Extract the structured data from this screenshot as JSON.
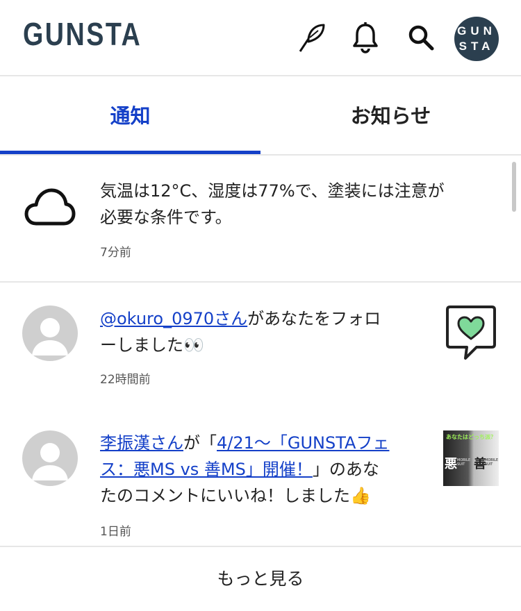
{
  "header": {
    "logo": "GUNSTA",
    "avatar_line1": "GUN",
    "avatar_line2": "STA"
  },
  "tabs": [
    {
      "label": "通知",
      "active": true
    },
    {
      "label": "お知らせ",
      "active": false
    }
  ],
  "notifications": [
    {
      "line1": "気温は12°C、湿度は77%で、塗装には注意が",
      "line2": "必要な条件です。",
      "time": "7分前"
    },
    {
      "user": "@okuro_0970さん",
      "line1_rest": "があなたをフォロ",
      "line2": "ーしました👀",
      "time": "22時間前"
    },
    {
      "user": "李振漢さん",
      "mid1": "が「",
      "link_line1": "4/21〜「GUNSTAフェ",
      "link_line2": "ス：悪MS vs 善MS」開催！",
      "rest2": "」のあな",
      "line3": "たのコメントにいいね！しました👍",
      "time": "1日前"
    }
  ],
  "thumbnail": {
    "title": "あなたはどっち派？",
    "left_kanji": "悪",
    "right_kanji": "善",
    "caption_left": "MOBILE SUIT",
    "caption_right": "MOBILE SUIT"
  },
  "footer": {
    "more_label": "もっと見る"
  },
  "colors": {
    "accent": "#1440c8",
    "logo": "#2b3f4f",
    "heart": "#7fd99a"
  }
}
